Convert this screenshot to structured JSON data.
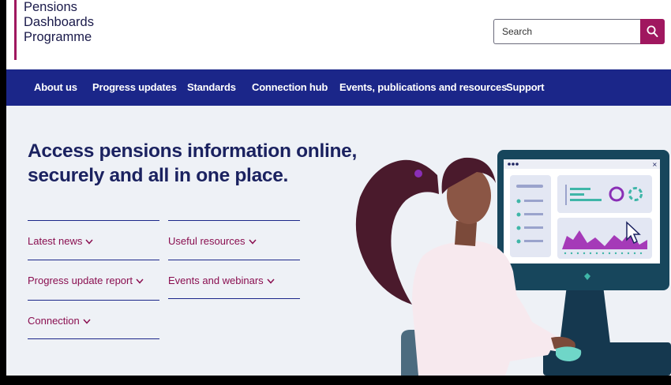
{
  "header": {
    "logo_lines": [
      "Pensions",
      "Dashboards",
      "Programme"
    ],
    "search": {
      "placeholder": "Search",
      "value": ""
    }
  },
  "nav": {
    "items": [
      "About us",
      "Progress updates",
      "Standards",
      "Connection hub",
      "Events, publications and resources",
      "Support"
    ]
  },
  "hero": {
    "title": "Access pensions information online, securely and all in one place.",
    "quick_links": [
      "Latest news",
      "Useful resources",
      "Progress update report",
      "Events and webinars",
      "Connection"
    ]
  },
  "colors": {
    "brand_magenta": "#a0175f",
    "nav_blue": "#1b2689",
    "title_navy": "#1b2260",
    "hero_bg": "#eef1f6"
  },
  "icons": [
    "search-icon",
    "chevron-down-icon"
  ]
}
